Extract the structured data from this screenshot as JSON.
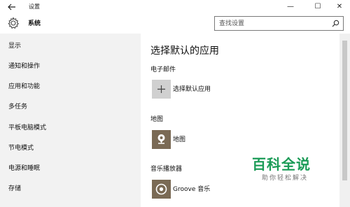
{
  "window": {
    "back_icon": "back-arrow-icon",
    "title": "设置",
    "controls": {
      "minimize": "—",
      "maximize": "☐",
      "close": "✕"
    }
  },
  "header": {
    "icon": "gear-icon",
    "section_title": "系统",
    "search": {
      "placeholder": "查找设置",
      "value": "",
      "icon": "search-icon"
    }
  },
  "sidebar": {
    "items": [
      {
        "label": "显示"
      },
      {
        "label": "通知和操作"
      },
      {
        "label": "应用和功能"
      },
      {
        "label": "多任务"
      },
      {
        "label": "平板电脑模式"
      },
      {
        "label": "节电模式"
      },
      {
        "label": "电源和睡眠"
      },
      {
        "label": "存储"
      }
    ]
  },
  "main": {
    "title": "选择默认的应用",
    "categories": [
      {
        "label": "电子邮件",
        "app": "选择默认应用",
        "icon": "plus-icon"
      },
      {
        "label": "地图",
        "app": "地图",
        "icon": "maps-icon"
      },
      {
        "label": "音乐播放器",
        "app": "Groove 音乐",
        "icon": "groove-music-icon"
      }
    ]
  },
  "watermark": {
    "main": "百科全说",
    "sub": "助你轻松解决"
  },
  "colors": {
    "sidebar_bg": "#f2f2f2",
    "tile_gray": "#d0d0d0",
    "tile_brown": "#7a6a55",
    "watermark_green": "#1a9b56"
  }
}
